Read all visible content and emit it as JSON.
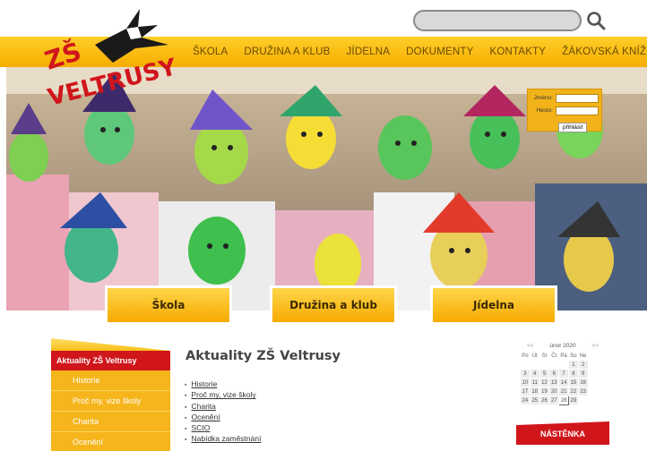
{
  "search": {
    "placeholder": "",
    "value": ""
  },
  "logo": {
    "line1": "ZŠ",
    "line2": "VELTRUSY"
  },
  "nav": [
    "ŠKOLA",
    "DRUŽINA A KLUB",
    "JÍDELNA",
    "DOKUMENTY",
    "KONTAKTY",
    "ŽÁKOVSKÁ KNÍŽKA"
  ],
  "login": {
    "name_label": "Jméno:",
    "pass_label": "Heslo:",
    "submit": "přihlásit"
  },
  "tiles": [
    "Škola",
    "Družina a klub",
    "Jídelna"
  ],
  "sidebar": {
    "active": "Aktuality ZŠ Veltrusy",
    "items": [
      "Historie",
      "Proč my, vize školy",
      "Charita",
      "Ocenění"
    ]
  },
  "content": {
    "title": "Aktuality ZŠ Veltrusy",
    "links": [
      "Historie",
      "Proč my, vize školy",
      "Charita",
      "Ocenění",
      "SCIO",
      "Nabídka zaměstnání"
    ]
  },
  "calendar": {
    "prev": "<<",
    "next": ">>",
    "month": "únor 2020",
    "weekdays": [
      "Po",
      "Út",
      "St",
      "Čt",
      "Pá",
      "So",
      "Ne"
    ],
    "weeks": [
      [
        "",
        "",
        "",
        "",
        "",
        "1",
        "2"
      ],
      [
        "3",
        "4",
        "5",
        "6",
        "7",
        "8",
        "9"
      ],
      [
        "10",
        "11",
        "12",
        "13",
        "14",
        "15",
        "16"
      ],
      [
        "17",
        "18",
        "19",
        "20",
        "21",
        "22",
        "23"
      ],
      [
        "24",
        "25",
        "26",
        "27",
        "28",
        "29",
        ""
      ]
    ],
    "today": "28"
  },
  "board": {
    "label": "NÁSTĚNKA"
  },
  "colors": {
    "yellow": "#f6ad00",
    "red": "#d0161b",
    "nav_text": "#6b4a00"
  },
  "icons": {
    "search": "magnifier-icon",
    "logo_bird": "magpie-bird-icon"
  }
}
